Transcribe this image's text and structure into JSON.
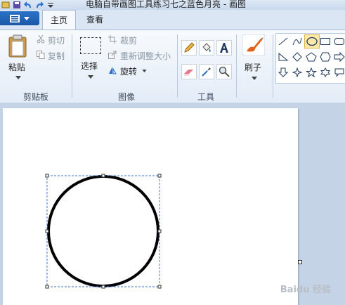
{
  "window": {
    "title": "电脑自带画图工具练习七之蓝色月亮 - 画图"
  },
  "tabs": {
    "home": "主页",
    "view": "查看"
  },
  "clipboard": {
    "paste": "粘贴",
    "cut": "剪切",
    "copy": "复制",
    "group": "剪贴板"
  },
  "image": {
    "select": "选择",
    "crop": "裁剪",
    "resize": "重新调整大小",
    "rotate": "旋转",
    "group": "图像"
  },
  "tools": {
    "group": "工具"
  },
  "brushes": {
    "label": "刷子"
  },
  "watermark": "Baidu 经验"
}
